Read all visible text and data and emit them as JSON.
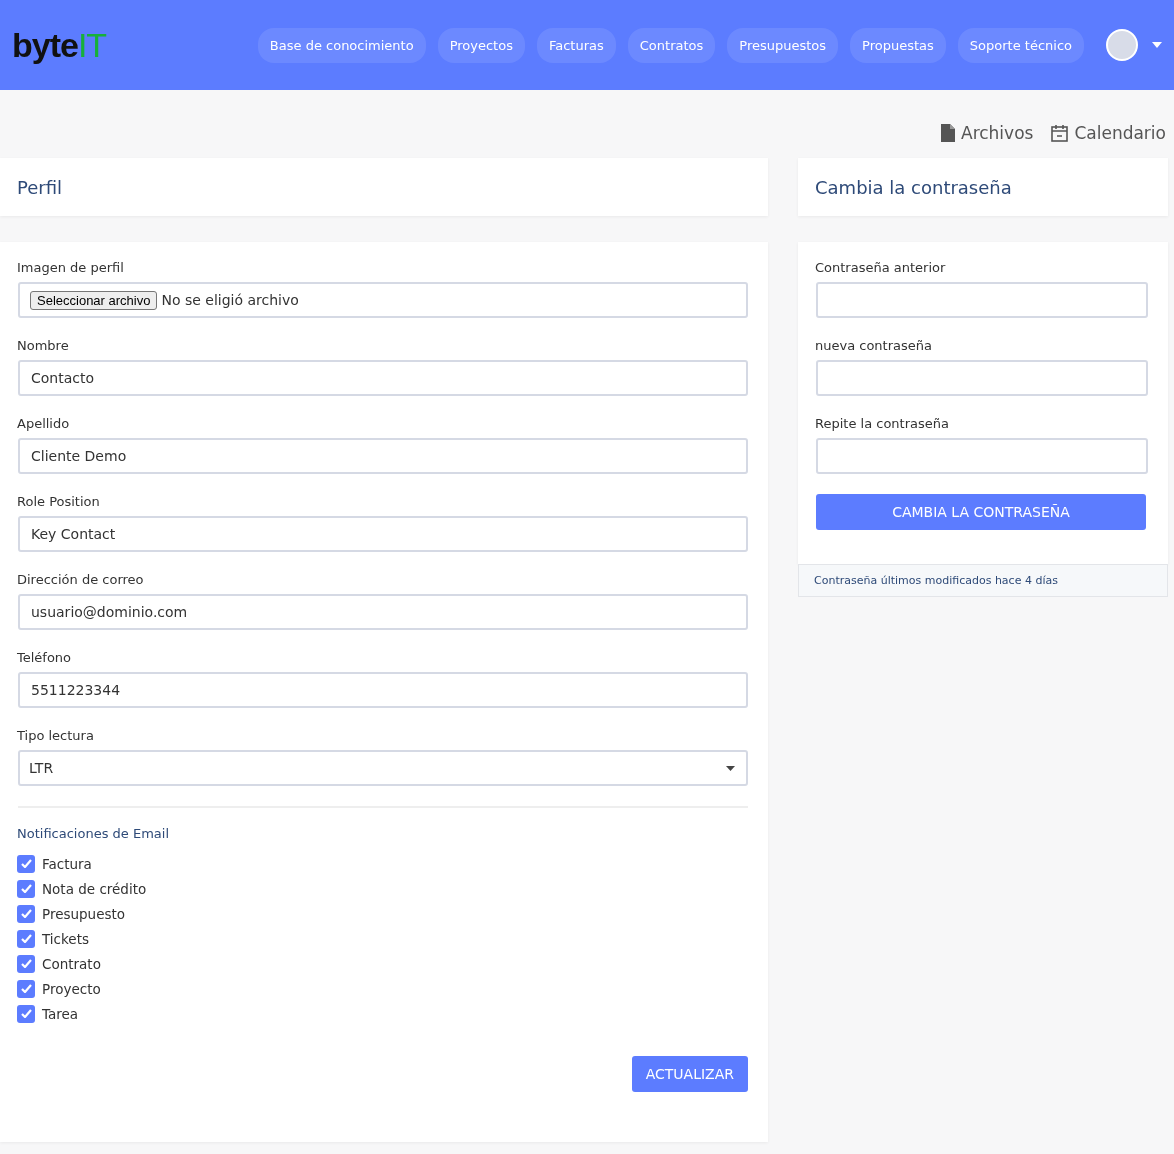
{
  "logo": {
    "text": "byte",
    "accent": "IT"
  },
  "nav": [
    "Base de conocimiento",
    "Proyectos",
    "Facturas",
    "Contratos",
    "Presupuestos",
    "Propuestas",
    "Soporte técnico"
  ],
  "toolbar": [
    {
      "kind": "file",
      "label": "Archivos"
    },
    {
      "kind": "calendar",
      "label": "Calendario"
    }
  ],
  "profile": {
    "title": "Perfil",
    "fields": [
      {
        "kind": "file",
        "label": "Imagen de perfil",
        "button": "Seleccionar archivo",
        "value": "No se eligió archivo"
      },
      {
        "kind": "text",
        "label": "Nombre",
        "value": "Contacto"
      },
      {
        "kind": "text",
        "label": "Apellido",
        "value": "Cliente Demo"
      },
      {
        "kind": "text",
        "label": "Role Position",
        "value": "Key Contact"
      },
      {
        "kind": "text",
        "label": "Dirección de correo",
        "value": "usuario@dominio.com"
      },
      {
        "kind": "text",
        "label": "Teléfono",
        "value": "5511223344"
      },
      {
        "kind": "select",
        "label": "Tipo lectura",
        "value": "LTR"
      }
    ],
    "notifications_title": "Notificaciones de Email",
    "notifications": [
      {
        "label": "Factura",
        "checked": true
      },
      {
        "label": "Nota de crédito",
        "checked": true
      },
      {
        "label": "Presupuesto",
        "checked": true
      },
      {
        "label": "Tickets",
        "checked": true
      },
      {
        "label": "Contrato",
        "checked": true
      },
      {
        "label": "Proyecto",
        "checked": true
      },
      {
        "label": "Tarea",
        "checked": true
      }
    ],
    "submit": "ACTUALIZAR"
  },
  "password": {
    "title": "Cambia la contraseña",
    "fields": [
      {
        "label": "Contraseña anterior"
      },
      {
        "label": "nueva contraseña"
      },
      {
        "label": "Repite la contraseña"
      }
    ],
    "submit": "CAMBIA LA CONTRASEÑA",
    "footer": "Contraseña últimos modificados hace 4 días"
  }
}
